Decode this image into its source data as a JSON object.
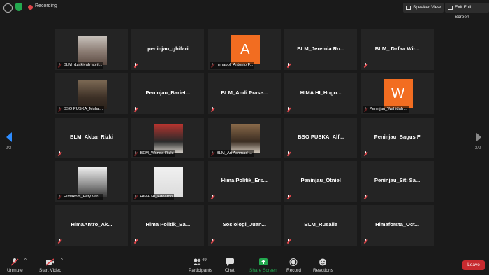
{
  "top_bar": {
    "recording_label": "Recording",
    "speaker_view_label": "Speaker View",
    "exit_full_screen_label": "Exit Full Screen"
  },
  "page_indicator": {
    "left": "2/2",
    "right": "2/2"
  },
  "participants": [
    {
      "label": "BLM_dzakiyah april...",
      "display": "photo"
    },
    {
      "label": "peninjau_ghifari",
      "display": "name"
    },
    {
      "label": "himapol_Antonio F...",
      "display": "avatar",
      "letter": "A"
    },
    {
      "label": "BLM_Jeremia  Ro...",
      "display": "name"
    },
    {
      "label": "BLM_ Dafaa  Wir...",
      "display": "name"
    },
    {
      "label": "BSO PUSKA_Muha...",
      "display": "photo"
    },
    {
      "label": "Peninjau_Bariet...",
      "display": "name"
    },
    {
      "label": "BLM_Andi  Prase...",
      "display": "name"
    },
    {
      "label": "HIMA  HI_Hugo...",
      "display": "name"
    },
    {
      "label": "Peninjau_Wahidah ...",
      "display": "avatar",
      "letter": "W"
    },
    {
      "label": "BLM_Akbar Rizki",
      "display": "name"
    },
    {
      "label": "BEM_Wanda Rizki",
      "display": "photo"
    },
    {
      "label": "BLM_Ari  Achmad ...",
      "display": "photo"
    },
    {
      "label": "BSO  PUSKA_Alf...",
      "display": "name"
    },
    {
      "label": "Peninjau_Bagus F",
      "display": "name"
    },
    {
      "label": "Himakom_Fety Van...",
      "display": "photo"
    },
    {
      "label": "HIMA HI_Edoardo",
      "display": "photo"
    },
    {
      "label": "Hima  Politik_Ers...",
      "display": "name"
    },
    {
      "label": "Peninjau_Otniel",
      "display": "name"
    },
    {
      "label": "Peninjau_Siti  Sa...",
      "display": "name"
    },
    {
      "label": "HimaAntro_Ak...",
      "display": "name"
    },
    {
      "label": "Hima  Politik_Ba...",
      "display": "name"
    },
    {
      "label": "Sosiologi_Juan...",
      "display": "name"
    },
    {
      "label": "BLM_Rusalle",
      "display": "name"
    },
    {
      "label": "Himaforsta_Oct...",
      "display": "name"
    }
  ],
  "bottom_bar": {
    "unmute": "Unmute",
    "start_video": "Start Video",
    "participants": "Participants",
    "participant_count": "49",
    "chat": "Chat",
    "share_screen": "Share Screen",
    "record": "Record",
    "reactions": "Reactions",
    "leave": "Leave"
  },
  "colors": {
    "background": "#1a1a1a",
    "tile": "#242424",
    "avatar_orange": "#f26d21",
    "recording_red": "#e0454a",
    "share_green": "#23a94f",
    "leave_red": "#c72a2f",
    "nav_blue": "#2d8cff"
  }
}
